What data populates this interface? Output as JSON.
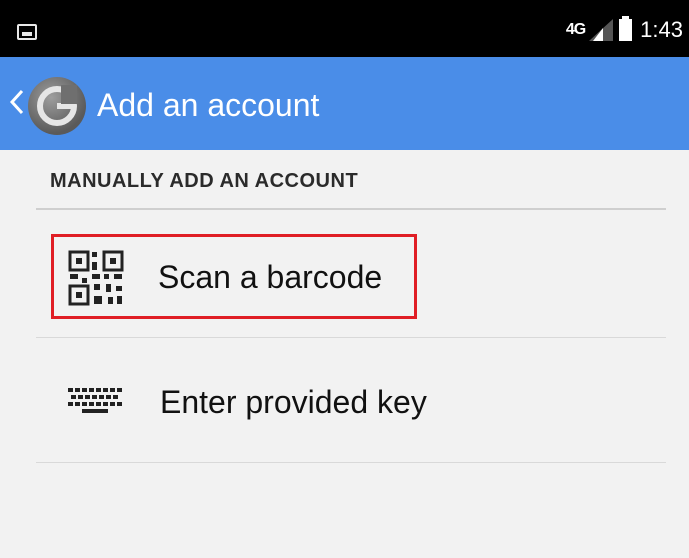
{
  "status_bar": {
    "network_label": "4G",
    "time": "1:43",
    "icons": [
      "gallery-icon",
      "signal-icon",
      "battery-icon"
    ]
  },
  "app_bar": {
    "title": "Add an account",
    "background_color": "#4a8de8"
  },
  "section": {
    "header": "MANUALLY ADD AN ACCOUNT"
  },
  "options": [
    {
      "label": "Scan a barcode",
      "icon": "qr-code-icon",
      "highlighted": true
    },
    {
      "label": "Enter provided key",
      "icon": "keyboard-icon",
      "highlighted": false
    }
  ],
  "highlight_color": "#e01e25"
}
